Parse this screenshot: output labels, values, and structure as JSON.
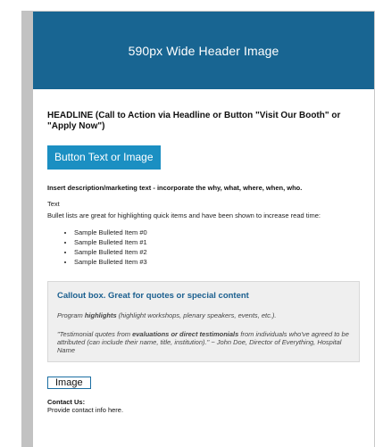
{
  "header": {
    "image_label": "590px Wide Header Image"
  },
  "headline": "HEADLINE (Call to Action via Headline or Button \"Visit Our Booth\" or \"Apply Now\")",
  "button_label": "Button Text or Image",
  "description": "Insert description/marketing text - incorporate the why, what, where, when, who.",
  "text_label": "Text",
  "bullet_intro": "Bullet lists are great for highlighting quick items and have been shown to increase read time:",
  "bullets": [
    "Sample Bulleted Item #0",
    "Sample Bulleted Item #1",
    "Sample Bulleted Item #2",
    "Sample Bulleted Item #3"
  ],
  "callout": {
    "title_a": "Callout box.",
    "title_b": " Great for quotes or special content",
    "p1_a": "Program ",
    "p1_b": "highlights",
    "p1_c": " (highlight workshops, plenary speakers, events, etc.).",
    "p2_a": "\"Testimonial quotes from ",
    "p2_b": "evaluations or direct testimonials",
    "p2_c": " from individuals who've agreed to be attributed (can include their name, title, institution).\" ~ John Doe, Director of Everything, Hospital Name"
  },
  "image_placeholder": "Image",
  "contact": {
    "heading": "Contact Us:",
    "body": "Provide contact info here."
  },
  "colors": {
    "header_bg": "#186592",
    "button_bg": "#1b8fc2",
    "callout_title": "#1a5f8f"
  }
}
